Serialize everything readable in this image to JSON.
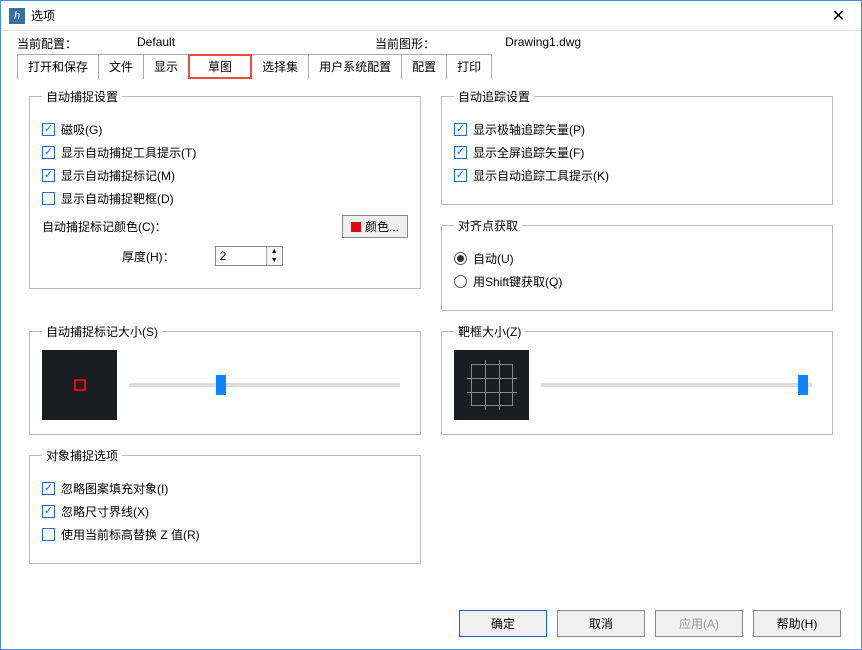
{
  "window": {
    "title": "选项"
  },
  "info": {
    "config_label": "当前配置：",
    "config_value": "Default",
    "drawing_label": "当前图形：",
    "drawing_value": "Drawing1.dwg"
  },
  "tabs": {
    "open_save": "打开和保存",
    "file": "文件",
    "display": "显示",
    "sketch": "草图",
    "selection": "选择集",
    "user_pref": "用户系统配置",
    "config": "配置",
    "print": "打印"
  },
  "autosnap": {
    "legend": "自动捕捉设置",
    "magnet": "磁吸(G)",
    "tooltip": "显示自动捕捉工具提示(T)",
    "marker": "显示自动捕捉标记(M)",
    "aperture": "显示自动捕捉靶框(D)",
    "color_label": "自动捕捉标记颜色(C)：",
    "color_btn": "颜色...",
    "thickness_label": "厚度(H)：",
    "thickness_value": "2"
  },
  "autotrack": {
    "legend": "自动追踪设置",
    "polar": "显示极轴追踪矢量(P)",
    "fullscreen": "显示全屏追踪矢量(F)",
    "tooltip": "显示自动追踪工具提示(K)"
  },
  "alignment": {
    "legend": "对齐点获取",
    "auto": "自动(U)",
    "shift": "用Shift键获取(Q)"
  },
  "marker_size": {
    "legend": "自动捕捉标记大小(S)"
  },
  "aperture_size": {
    "legend": "靶框大小(Z)"
  },
  "osnap": {
    "legend": "对象捕捉选项",
    "ignore_hatch": "忽略图案填充对象(I)",
    "ignore_dim": "忽略尺寸界线(X)",
    "use_elev": "使用当前标高替换 Z 值(R)"
  },
  "buttons": {
    "ok": "确定",
    "cancel": "取消",
    "apply": "应用(A)",
    "help": "帮助(H)"
  }
}
